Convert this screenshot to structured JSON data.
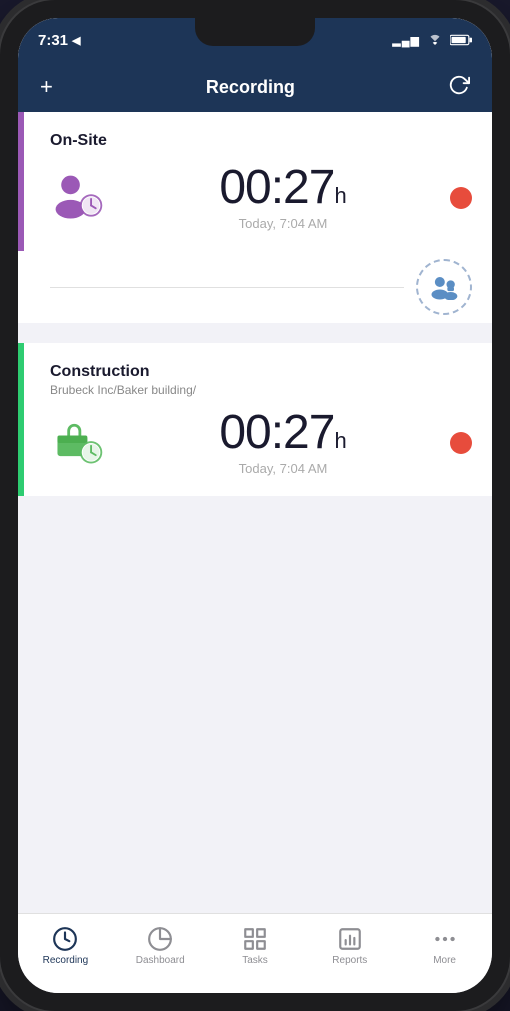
{
  "status": {
    "time": "7:31",
    "location_icon": "◀",
    "signal_bars": "▂▄▆",
    "wifi": "wifi",
    "battery": "battery"
  },
  "header": {
    "title": "Recording",
    "add_label": "+",
    "refresh_label": "↺"
  },
  "sections": [
    {
      "id": "on-site",
      "type": "purple",
      "title": "On-Site",
      "subtitle": null,
      "time_value": "00:27",
      "time_unit": "h",
      "time_label": "Today, 7:04 AM",
      "icon_color": "#9b59b6",
      "has_worker_btn": true
    },
    {
      "id": "construction",
      "type": "green",
      "title": "Construction",
      "subtitle": "Brubeck Inc/Baker building/",
      "time_value": "00:27",
      "time_unit": "h",
      "time_label": "Today, 7:04 AM",
      "icon_color": "#5dbb63",
      "has_worker_btn": false
    }
  ],
  "nav": {
    "items": [
      {
        "id": "recording",
        "label": "Recording",
        "icon": "clock",
        "active": true
      },
      {
        "id": "dashboard",
        "label": "Dashboard",
        "icon": "chart",
        "active": false
      },
      {
        "id": "tasks",
        "label": "Tasks",
        "icon": "tasks",
        "active": false
      },
      {
        "id": "reports",
        "label": "Reports",
        "icon": "reports",
        "active": false
      },
      {
        "id": "more",
        "label": "More",
        "icon": "more",
        "active": false
      }
    ]
  }
}
